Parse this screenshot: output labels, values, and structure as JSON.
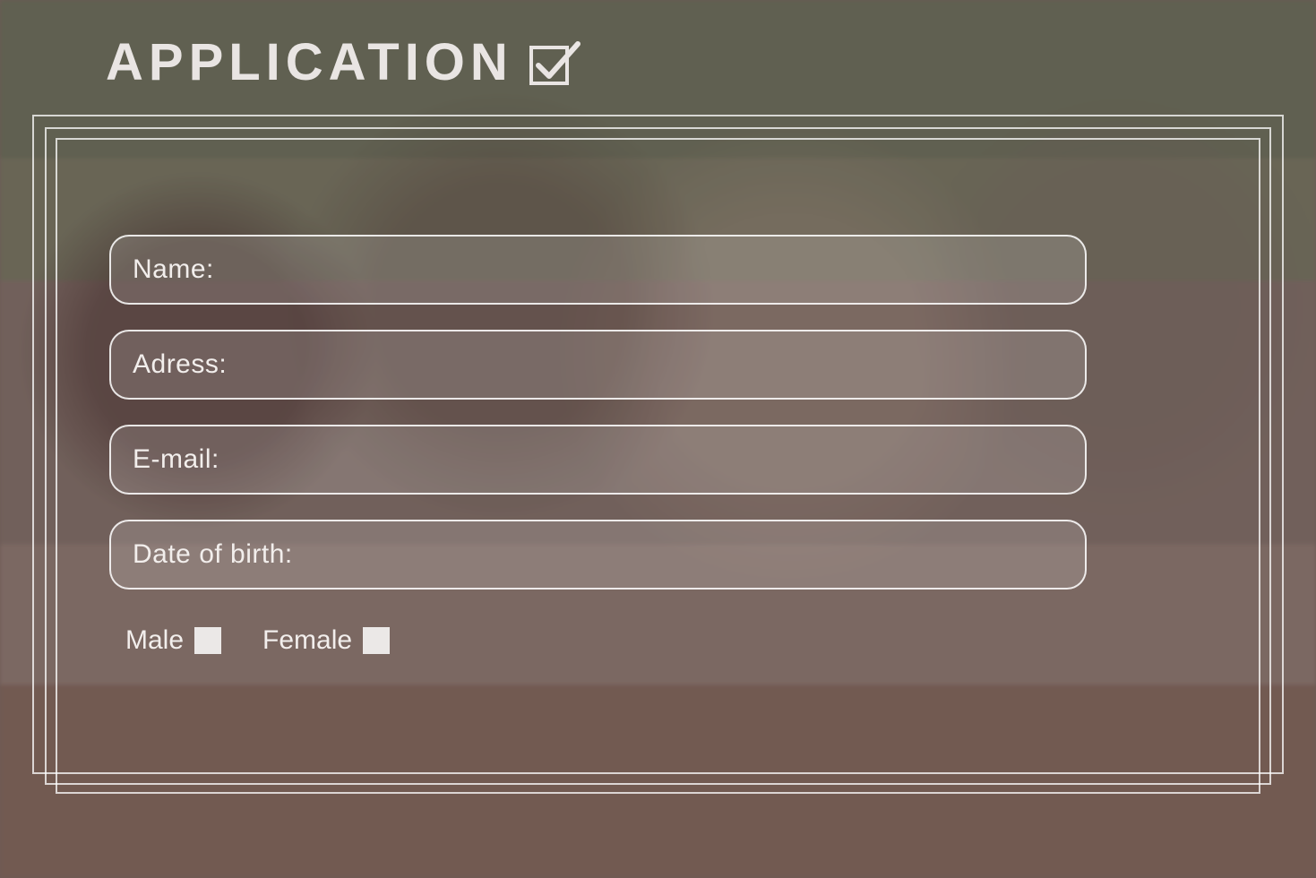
{
  "header": {
    "title": "APPLICATION"
  },
  "form": {
    "fields": [
      {
        "label": "Name:"
      },
      {
        "label": "Adress:"
      },
      {
        "label": "E-mail:"
      },
      {
        "label": "Date of birth:"
      }
    ],
    "gender": {
      "options": [
        {
          "label": "Male"
        },
        {
          "label": "Female"
        }
      ]
    }
  }
}
